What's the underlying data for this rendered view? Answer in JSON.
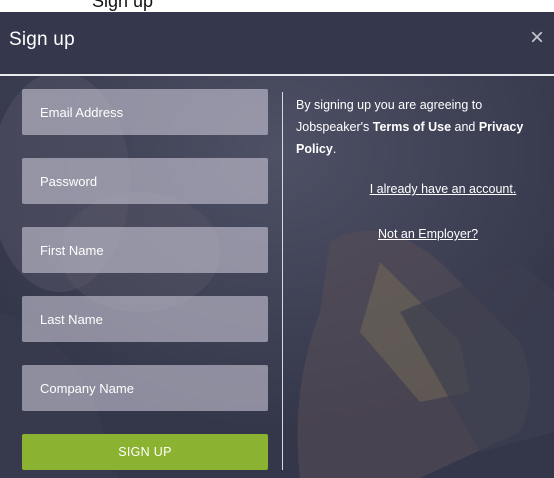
{
  "page_partial_text": "Sign up",
  "modal": {
    "title": "Sign up",
    "close_glyph": "×",
    "close_icon": "close-icon"
  },
  "form": {
    "email_placeholder": "Email Address",
    "password_placeholder": "Password",
    "first_name_placeholder": "First Name",
    "last_name_placeholder": "Last Name",
    "company_name_placeholder": "Company Name",
    "submit_label": "SIGN UP"
  },
  "agreement": {
    "prefix": "By signing up you are agreeing to Jobspeaker's",
    "terms_link": "Terms of Use",
    "conjunction": "and",
    "privacy_link": "Privacy Policy",
    "suffix": "."
  },
  "links": {
    "existing_account": "I already have an account.",
    "not_employer": "Not an Employer?"
  },
  "colors": {
    "header_bg": "#35374c",
    "field_bg": "rgba(205,203,219,0.58)",
    "button_green": "#8bb331",
    "text": "#ffffff"
  }
}
